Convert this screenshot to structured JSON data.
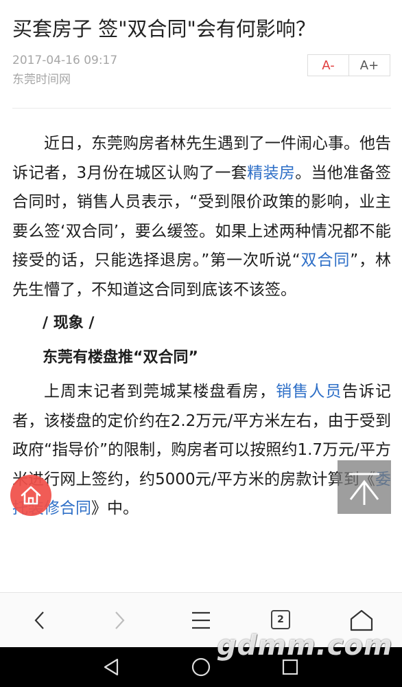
{
  "article": {
    "title": "买套房子 签\"双合同\"会有何影响？",
    "date": "2017-04-16 09:17",
    "source": "东莞时间网"
  },
  "font_controls": {
    "decrease": "A-",
    "increase": "A+"
  },
  "content": {
    "p1": [
      "近日，东莞购房者林先生遇到了一件闹心事。他告诉记者，3月份在城区认购了一套",
      "精装房",
      "。当他准备签合同时，销售人员表示，“受到限价政策的影响，业主要么签‘双合同’，要么缓签。如果上述两种情况都不能接受的话，只能选择退房。”第一次听说“",
      "双合同",
      "”，林先生懵了，不知道这合同到底该不该签。"
    ],
    "h1": "/ 现象 /",
    "h2": "东莞有楼盘推“双合同”",
    "p2": [
      "上周末记者到莞城某楼盘看房，",
      "销售人员",
      "告诉记者，该楼盘的定价约在2.2万元/平方米左右，由于受到政府“指导价”的限制，购房者可以按照约1.7万元/平方米进行网上签约，约5000元/平方米的房款计算到《",
      "委托装修合同",
      "》中。"
    ]
  },
  "browser": {
    "tab_count": "2"
  },
  "watermark": "gdmm.com",
  "colors": {
    "link": "#2e6fc7",
    "accent": "#e03b3b",
    "fab": "#f0504a"
  },
  "icons": {
    "home": "home-icon",
    "top": "back-to-top-icon",
    "back": "chevron-left-icon",
    "forward": "chevron-right-icon",
    "menu": "hamburger-menu-icon",
    "tabs": "tabs-icon",
    "browser_home": "house-outline-icon",
    "nav_back": "triangle-back-icon",
    "nav_home": "circle-home-icon",
    "nav_recent": "square-recents-icon"
  }
}
